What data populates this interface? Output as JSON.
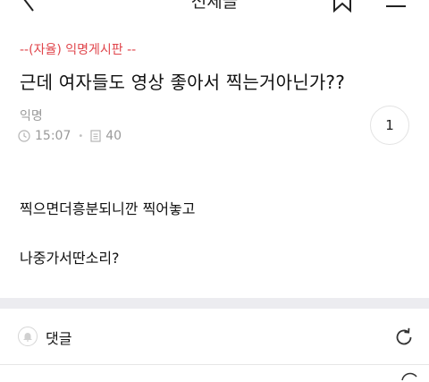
{
  "topbar": {
    "title": "전체글"
  },
  "post": {
    "board": "--(자율) 익명게시판 --",
    "title": "근데 여자들도 영상 좋아서 찍는거아닌가??",
    "author": "익명",
    "time": "15:07",
    "views": "40",
    "comment_count": "1",
    "body_lines": [
      "찍으면더흥분되니깐 찍어놓고",
      "나중가서딴소리?"
    ]
  },
  "comments": {
    "label": "댓글"
  },
  "colors": {
    "board_label": "#e0454b",
    "meta_text": "#9a9a9a",
    "divider": "#ececf0"
  }
}
